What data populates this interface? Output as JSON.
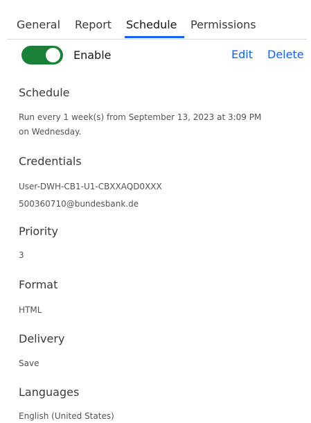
{
  "tabs": [
    {
      "label": "General"
    },
    {
      "label": "Report"
    },
    {
      "label": "Schedule",
      "active": true
    },
    {
      "label": "Permissions"
    }
  ],
  "toggle": {
    "label": "Enable",
    "enabled": true
  },
  "actions": {
    "edit": "Edit",
    "delete": "Delete"
  },
  "schedule": {
    "label": "Schedule",
    "line1": "Run every 1 week(s) from September 13, 2023 at 3:09 PM",
    "line2": "on Wednesday."
  },
  "credentials": {
    "label": "Credentials",
    "line1": "User-DWH-CB1-U1-CBXXAQD0XXX",
    "line2": "500360710@bundesbank.de"
  },
  "priority": {
    "label": "Priority",
    "value": "3"
  },
  "format": {
    "label": "Format",
    "value": "HTML"
  },
  "delivery": {
    "label": "Delivery",
    "value": "Save"
  },
  "languages": {
    "label": "Languages",
    "value": "English (United States)"
  },
  "colors": {
    "accent": "#0f62fe",
    "toggle_on": "#198038"
  }
}
